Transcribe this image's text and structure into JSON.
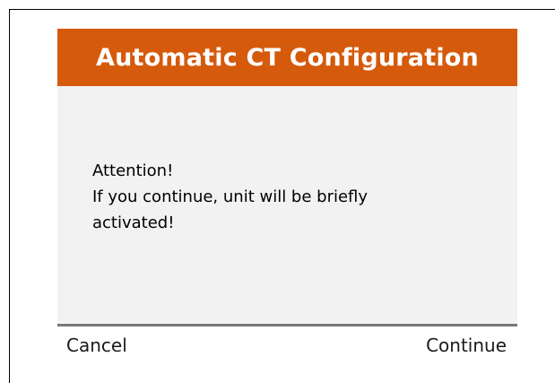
{
  "dialog": {
    "title": "Automatic CT Configuration",
    "message": {
      "heading": "Attention!",
      "line1": "If you continue, unit will be briefly",
      "line2": "activated!"
    }
  },
  "softkeys": {
    "cancel_label": "Cancel",
    "continue_label": "Continue"
  },
  "colors": {
    "title_bar": "#d55a0c",
    "dialog_background": "#f2f2f2",
    "divider": "#7a7a7a"
  }
}
